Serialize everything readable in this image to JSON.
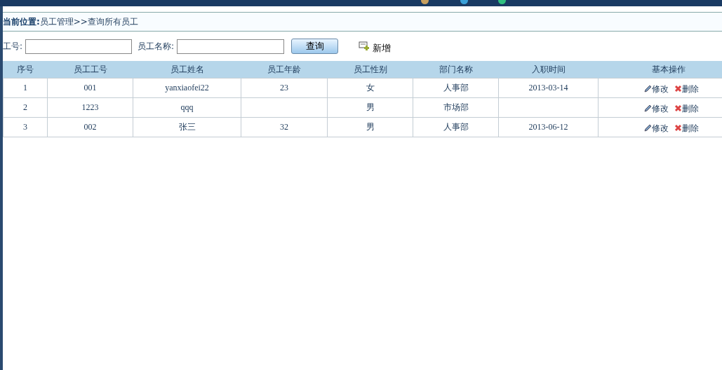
{
  "breadcrumb": {
    "label": "当前位置:",
    "path": "员工管理>>查询所有员工"
  },
  "search": {
    "fields": [
      {
        "label": "工号:"
      },
      {
        "label": "员工名称:"
      }
    ],
    "button": "查询",
    "add": "新增"
  },
  "table": {
    "columns": [
      "序号",
      "员工工号",
      "员工姓名",
      "员工年龄",
      "员工性别",
      "部门名称",
      "入职时间",
      "基本操作"
    ],
    "rows": [
      {
        "cells": [
          "1",
          "001",
          "yanxiaofei22",
          "23",
          "女",
          "人事部",
          "2013-03-14"
        ],
        "actions": [
          "修改",
          "删除"
        ]
      },
      {
        "cells": [
          "2",
          "1223",
          "qqq",
          "",
          "男",
          "市场部",
          ""
        ],
        "actions": [
          "修改",
          "删除"
        ]
      },
      {
        "cells": [
          "3",
          "002",
          "张三",
          "32",
          "男",
          "人事部",
          "2013-06-12"
        ],
        "actions": [
          "修改",
          "删除"
        ]
      }
    ]
  }
}
